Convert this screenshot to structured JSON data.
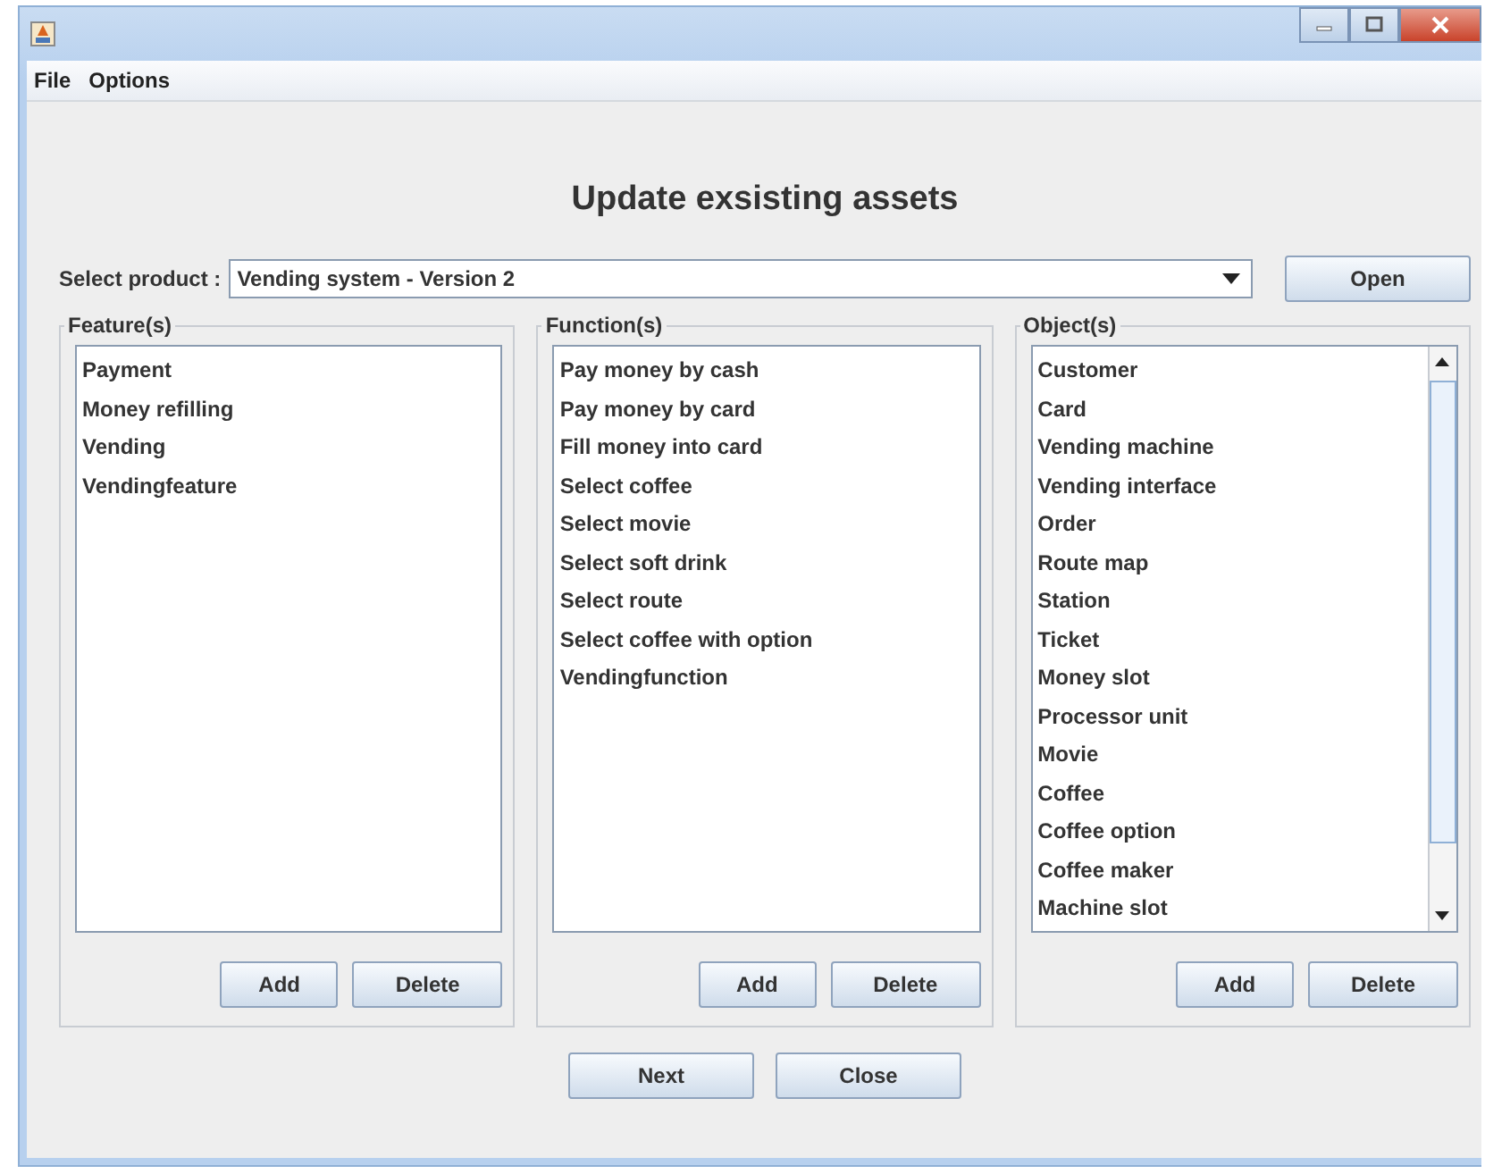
{
  "menu": [
    "File",
    "Options"
  ],
  "heading": "Update exsisting assets",
  "product": {
    "label": "Select product :",
    "value": "Vending system - Version 2",
    "button": "Open"
  },
  "panels": [
    {
      "title": "Feature(s)",
      "scrollbar": false,
      "items": [
        "Payment",
        "Money refilling",
        "Vending",
        "Vendingfeature"
      ],
      "buttons": [
        "Add",
        "Delete"
      ]
    },
    {
      "title": "Function(s)",
      "scrollbar": false,
      "items": [
        "Pay money by cash",
        "Pay money by card",
        "Fill money into card",
        "Select coffee",
        "Select movie",
        "Select soft drink",
        "Select route",
        "Select coffee with option",
        "Vendingfunction"
      ],
      "buttons": [
        "Add",
        "Delete"
      ]
    },
    {
      "title": "Object(s)",
      "scrollbar": true,
      "items": [
        "Customer",
        "Card",
        "Vending machine",
        "Vending interface",
        "Order",
        "Route map",
        "Station",
        "Ticket",
        "Money slot",
        "Processor unit",
        "Movie",
        "Coffee",
        "Coffee option",
        "Coffee maker",
        "Machine slot"
      ],
      "buttons": [
        "Add",
        "Delete"
      ]
    }
  ],
  "footer_buttons": [
    "Next",
    "Close"
  ]
}
